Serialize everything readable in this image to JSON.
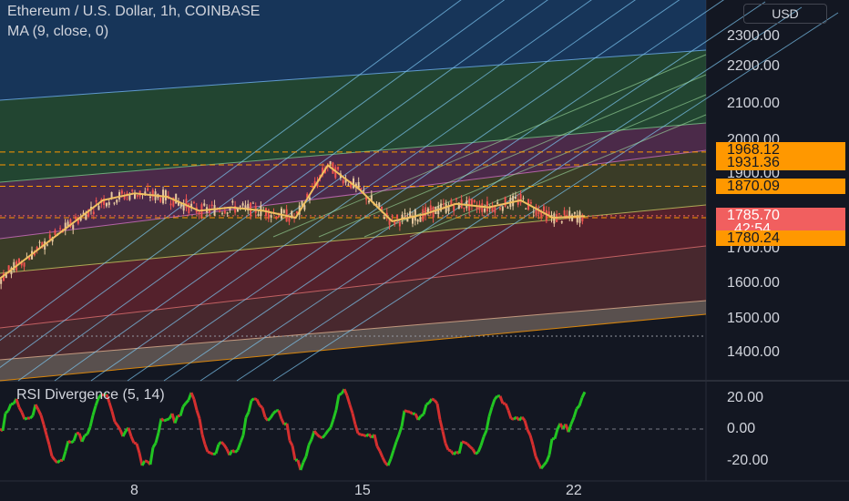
{
  "chart": {
    "title": "Ethereum / U.S. Dollar, 1h, COINBASE",
    "indicator": "MA (9, close, 0)",
    "currency_button": "USD",
    "rsi_title": "RSI Divergence (5, 14)"
  },
  "chart_data": [
    {
      "type": "line",
      "title": "Ethereum / U.S. Dollar, 1h, COINBASE",
      "x_ticks": [
        "8",
        "15",
        "22"
      ],
      "y_ticks": [
        "2300.00",
        "2200.00",
        "2100.00",
        "2000.00",
        "1900.00",
        "1700.00",
        "1600.00",
        "1500.00",
        "1400.00"
      ],
      "ylim": [
        1340,
        2350
      ],
      "price_tags": [
        {
          "label": "1968.12",
          "value": 1968.12,
          "color": "#ff9800"
        },
        {
          "label": "1931.36",
          "value": 1931.36,
          "color": "#ff9800"
        },
        {
          "label": "1870.09",
          "value": 1870.09,
          "color": "#ff9800"
        },
        {
          "label": "1780.24",
          "value": 1780.24,
          "color": "#ff9800"
        }
      ],
      "last_price": {
        "value": "1785.70",
        "countdown": "42:54",
        "color": "#f15f5f"
      },
      "series": [
        {
          "name": "MA (9, close, 0)",
          "x": [
            0,
            2,
            4,
            6,
            7,
            8,
            9,
            10,
            11,
            12,
            13,
            14,
            15,
            16,
            17,
            18,
            19,
            20,
            21,
            22
          ],
          "values": [
            1620,
            1480,
            1620,
            1760,
            1830,
            1850,
            1840,
            1800,
            1810,
            1800,
            1780,
            1930,
            1860,
            1770,
            1790,
            1820,
            1810,
            1830,
            1780,
            1785
          ]
        }
      ]
    },
    {
      "type": "bar",
      "title": "RSI Divergence (5, 14)",
      "y_ticks": [
        "20.00",
        "0.00",
        "-20.00"
      ],
      "ylim": [
        -30,
        30
      ]
    }
  ]
}
